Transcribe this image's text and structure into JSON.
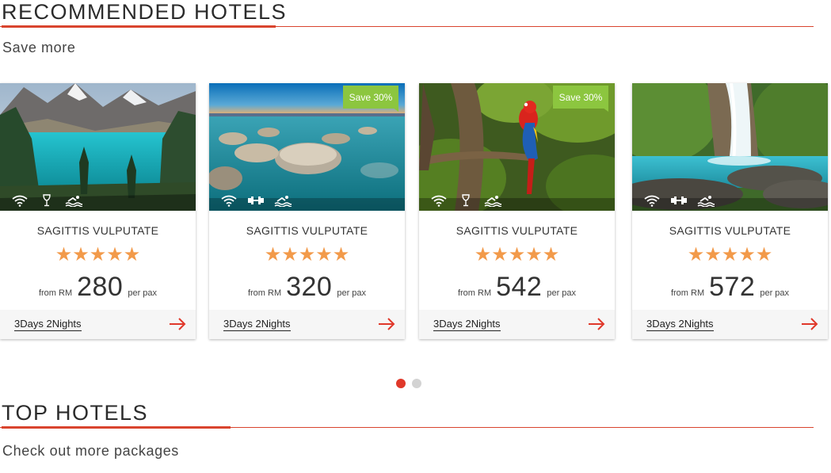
{
  "recommended": {
    "title": "RECOMMENDED HOTELS",
    "subtitle": "Save more"
  },
  "top": {
    "title": "TOP HOTELS",
    "subtitle": "Check out more packages"
  },
  "colors": {
    "accent": "#d9442e",
    "star": "#f29a4a",
    "badge": "#8cc63f",
    "dot_active": "#e0382a",
    "dot_inactive": "#d3d3d3"
  },
  "cards": [
    {
      "name": "SAGITTIS VULPUTATE",
      "stars": "★★★★★",
      "rating": 5,
      "from_label": "from RM",
      "price": "280",
      "per_label": "per pax",
      "duration": "3Days 2Nights",
      "badge": "",
      "image": "mountain-lake",
      "amenities": [
        "wifi-icon",
        "wine-glass-icon",
        "swimming-icon"
      ]
    },
    {
      "name": "SAGITTIS VULPUTATE",
      "stars": "★★★★★",
      "rating": 5,
      "from_label": "from RM",
      "price": "320",
      "per_label": "per pax",
      "duration": "3Days 2Nights",
      "badge": "Save 30%",
      "image": "rocky-shore-sunset",
      "amenities": [
        "wifi-icon",
        "dumbbell-icon",
        "swimming-icon"
      ]
    },
    {
      "name": "SAGITTIS VULPUTATE",
      "stars": "★★★★★",
      "rating": 5,
      "from_label": "from RM",
      "price": "542",
      "per_label": "per pax",
      "duration": "3Days 2Nights",
      "badge": "Save 30%",
      "image": "jungle-parrot",
      "amenities": [
        "wifi-icon",
        "wine-glass-icon",
        "swimming-icon"
      ]
    },
    {
      "name": "SAGITTIS VULPUTATE",
      "stars": "★★★★★",
      "rating": 5,
      "from_label": "from RM",
      "price": "572",
      "per_label": "per pax",
      "duration": "3Days 2Nights",
      "badge": "",
      "image": "waterfall",
      "amenities": [
        "wifi-icon",
        "dumbbell-icon",
        "swimming-icon"
      ]
    }
  ],
  "carousel": {
    "pages": 2,
    "active_page": 1
  }
}
